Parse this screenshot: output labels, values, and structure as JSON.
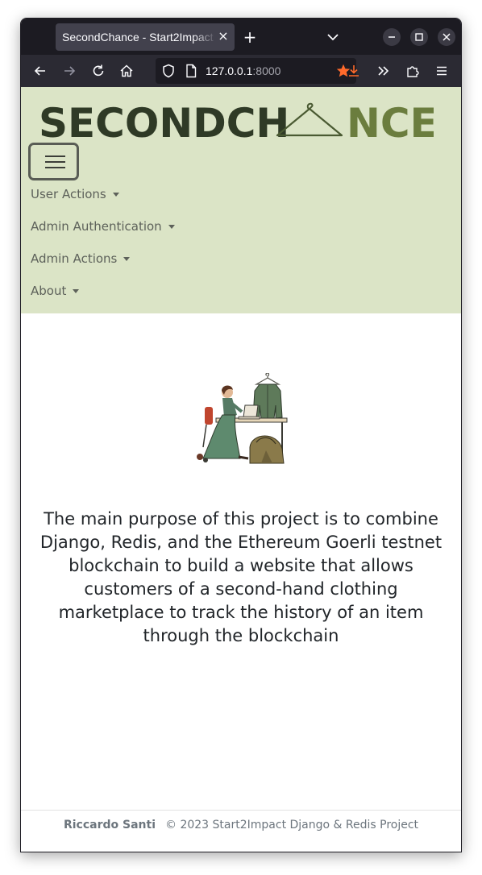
{
  "browser": {
    "tab_title": "SecondChance - Start2Impact",
    "tab_close_glyph": "×",
    "new_tab_glyph": "+",
    "url_host": "127.0.0.1",
    "url_port": ":8000"
  },
  "navbar": {
    "logo_text": "SECONDCH NCE",
    "items": [
      {
        "label": "User Actions"
      },
      {
        "label": "Admin Authentication"
      },
      {
        "label": "Admin Actions"
      },
      {
        "label": "About"
      }
    ]
  },
  "main": {
    "purpose_text": "The main purpose of this project is to combine Django, Redis, and the Ethereum Goerli testnet blockchain to build a website that allows customers of a second-hand clothing marketplace to track the history of an item through the blockchain",
    "illustration_icon": "woman-at-laptop-with-hanging-jacket-illustration"
  },
  "footer": {
    "author": "Riccardo Santi",
    "copyright": "© 2023 Start2Impact Django & Redis Project"
  },
  "colors": {
    "navbar_bg": "#dbe4c6",
    "logo_dark": "#2f3a26",
    "logo_green": "#6b7d3e",
    "bookmark_star": "#ff6a2b"
  }
}
